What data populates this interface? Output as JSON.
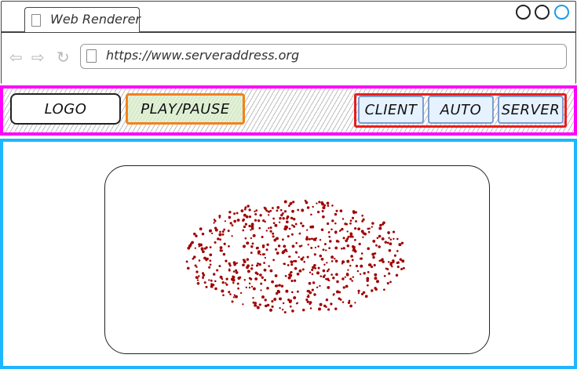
{
  "browser": {
    "tab_title": "Web Renderer",
    "url": "https://www.serveraddress.org",
    "window_controls": [
      "minimize",
      "maximize",
      "close"
    ],
    "nav_icons": [
      "back-icon",
      "forward-icon",
      "refresh-icon"
    ]
  },
  "toolbar": {
    "logo_label": "LOGO",
    "play_pause_label": "PLAY/PAUSE",
    "modes": [
      {
        "label": "CLIENT"
      },
      {
        "label": "AUTO"
      },
      {
        "label": "SERVER"
      }
    ]
  },
  "colors": {
    "toolbar_border": "#ff00ff",
    "viewport_border": "#1eb6ff",
    "mode_group_border": "#e81e1e",
    "play_button_border": "#f2821a",
    "play_button_fill": "#e2f1d8",
    "mode_button_fill": "#e6f2ff",
    "particle_color": "#a00000",
    "close_button_accent": "#1e9be8"
  },
  "render": {
    "particle_shape": "elliptical cloud",
    "particle_count": 620
  }
}
